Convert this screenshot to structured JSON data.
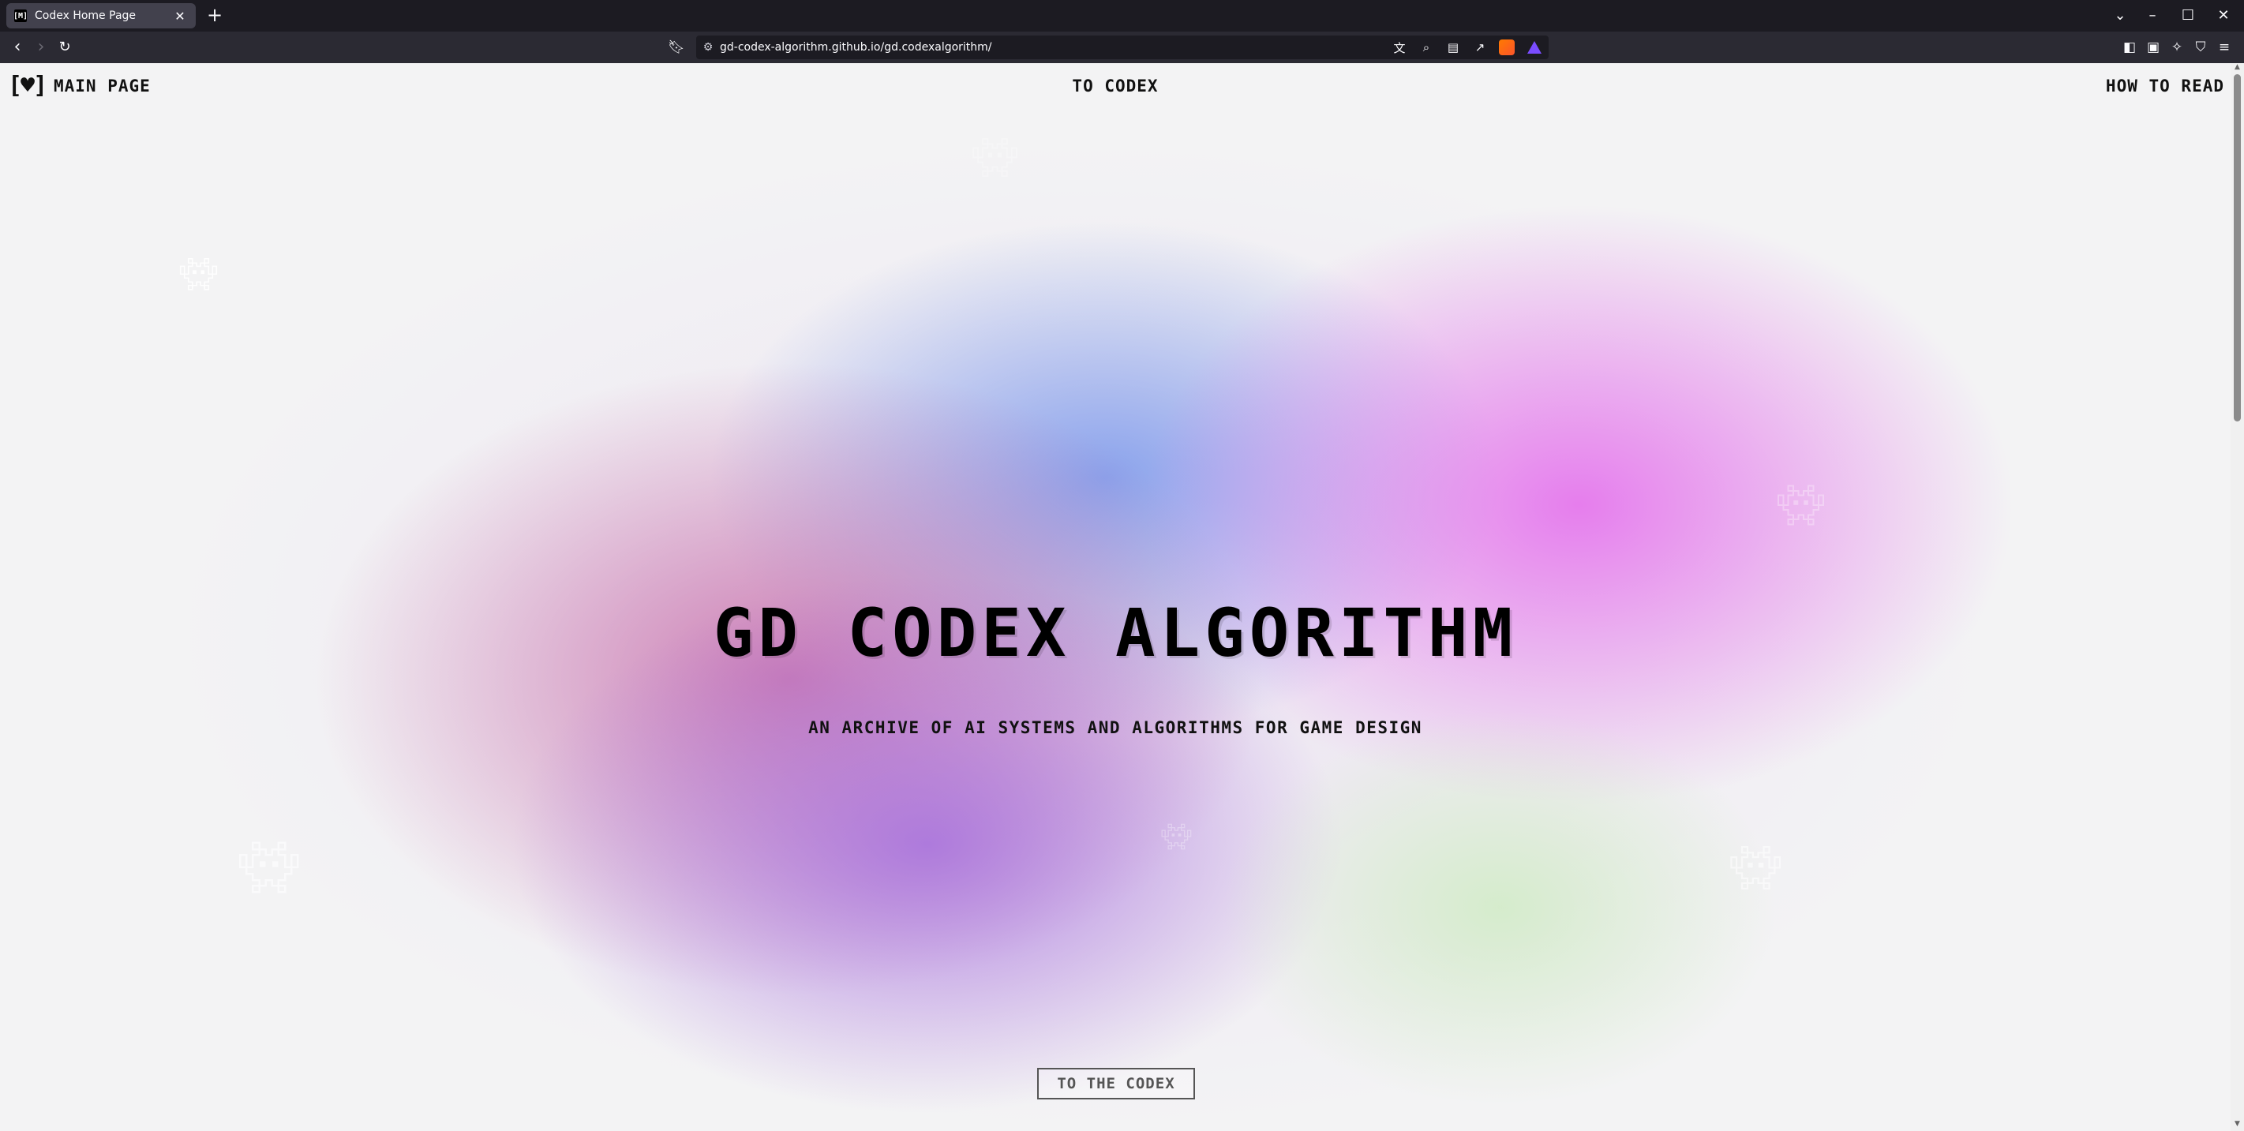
{
  "browser": {
    "tab_title": "Codex Home Page",
    "tab_favicon": "[M]",
    "url": "gd-codex-algorithm.github.io/gd.codexalgorithm/"
  },
  "icons": {
    "back": "back-arrow-icon",
    "forward": "forward-arrow-icon",
    "reload": "reload-icon",
    "bookmark": "bookmark-icon",
    "site_info": "site-info-icon",
    "translate": "translate-icon",
    "zoom": "zoom-icon",
    "reader": "reader-view-icon",
    "share": "share-icon",
    "sidebar": "sidebar-icon",
    "wallet": "wallet-icon",
    "leo": "leo-ai-icon",
    "vpn": "vpn-shield-icon",
    "menu": "menu-icon",
    "tab_list": "chevron-down-icon",
    "minimize": "minimize-icon",
    "maximize": "maximize-icon",
    "close": "close-icon"
  },
  "site": {
    "logo": "[♥]",
    "nav": {
      "main": "MAIN PAGE",
      "codex": "TO CODEX",
      "how": "HOW TO READ"
    },
    "hero": {
      "title": "GD CODEX ALGORITHM",
      "subtitle": "AN ARCHIVE OF AI SYSTEMS AND ALGORITHMS FOR GAME DESIGN"
    },
    "cta": "TO THE CODEX"
  },
  "colors": {
    "page_bg": "#f3f3f4",
    "blob_rose": "#c66aa8",
    "blob_blue": "#7896eb",
    "blob_pink": "#e46eec",
    "blob_purple": "#a56edc",
    "blob_green": "#d2ebc8",
    "text": "#000000"
  }
}
